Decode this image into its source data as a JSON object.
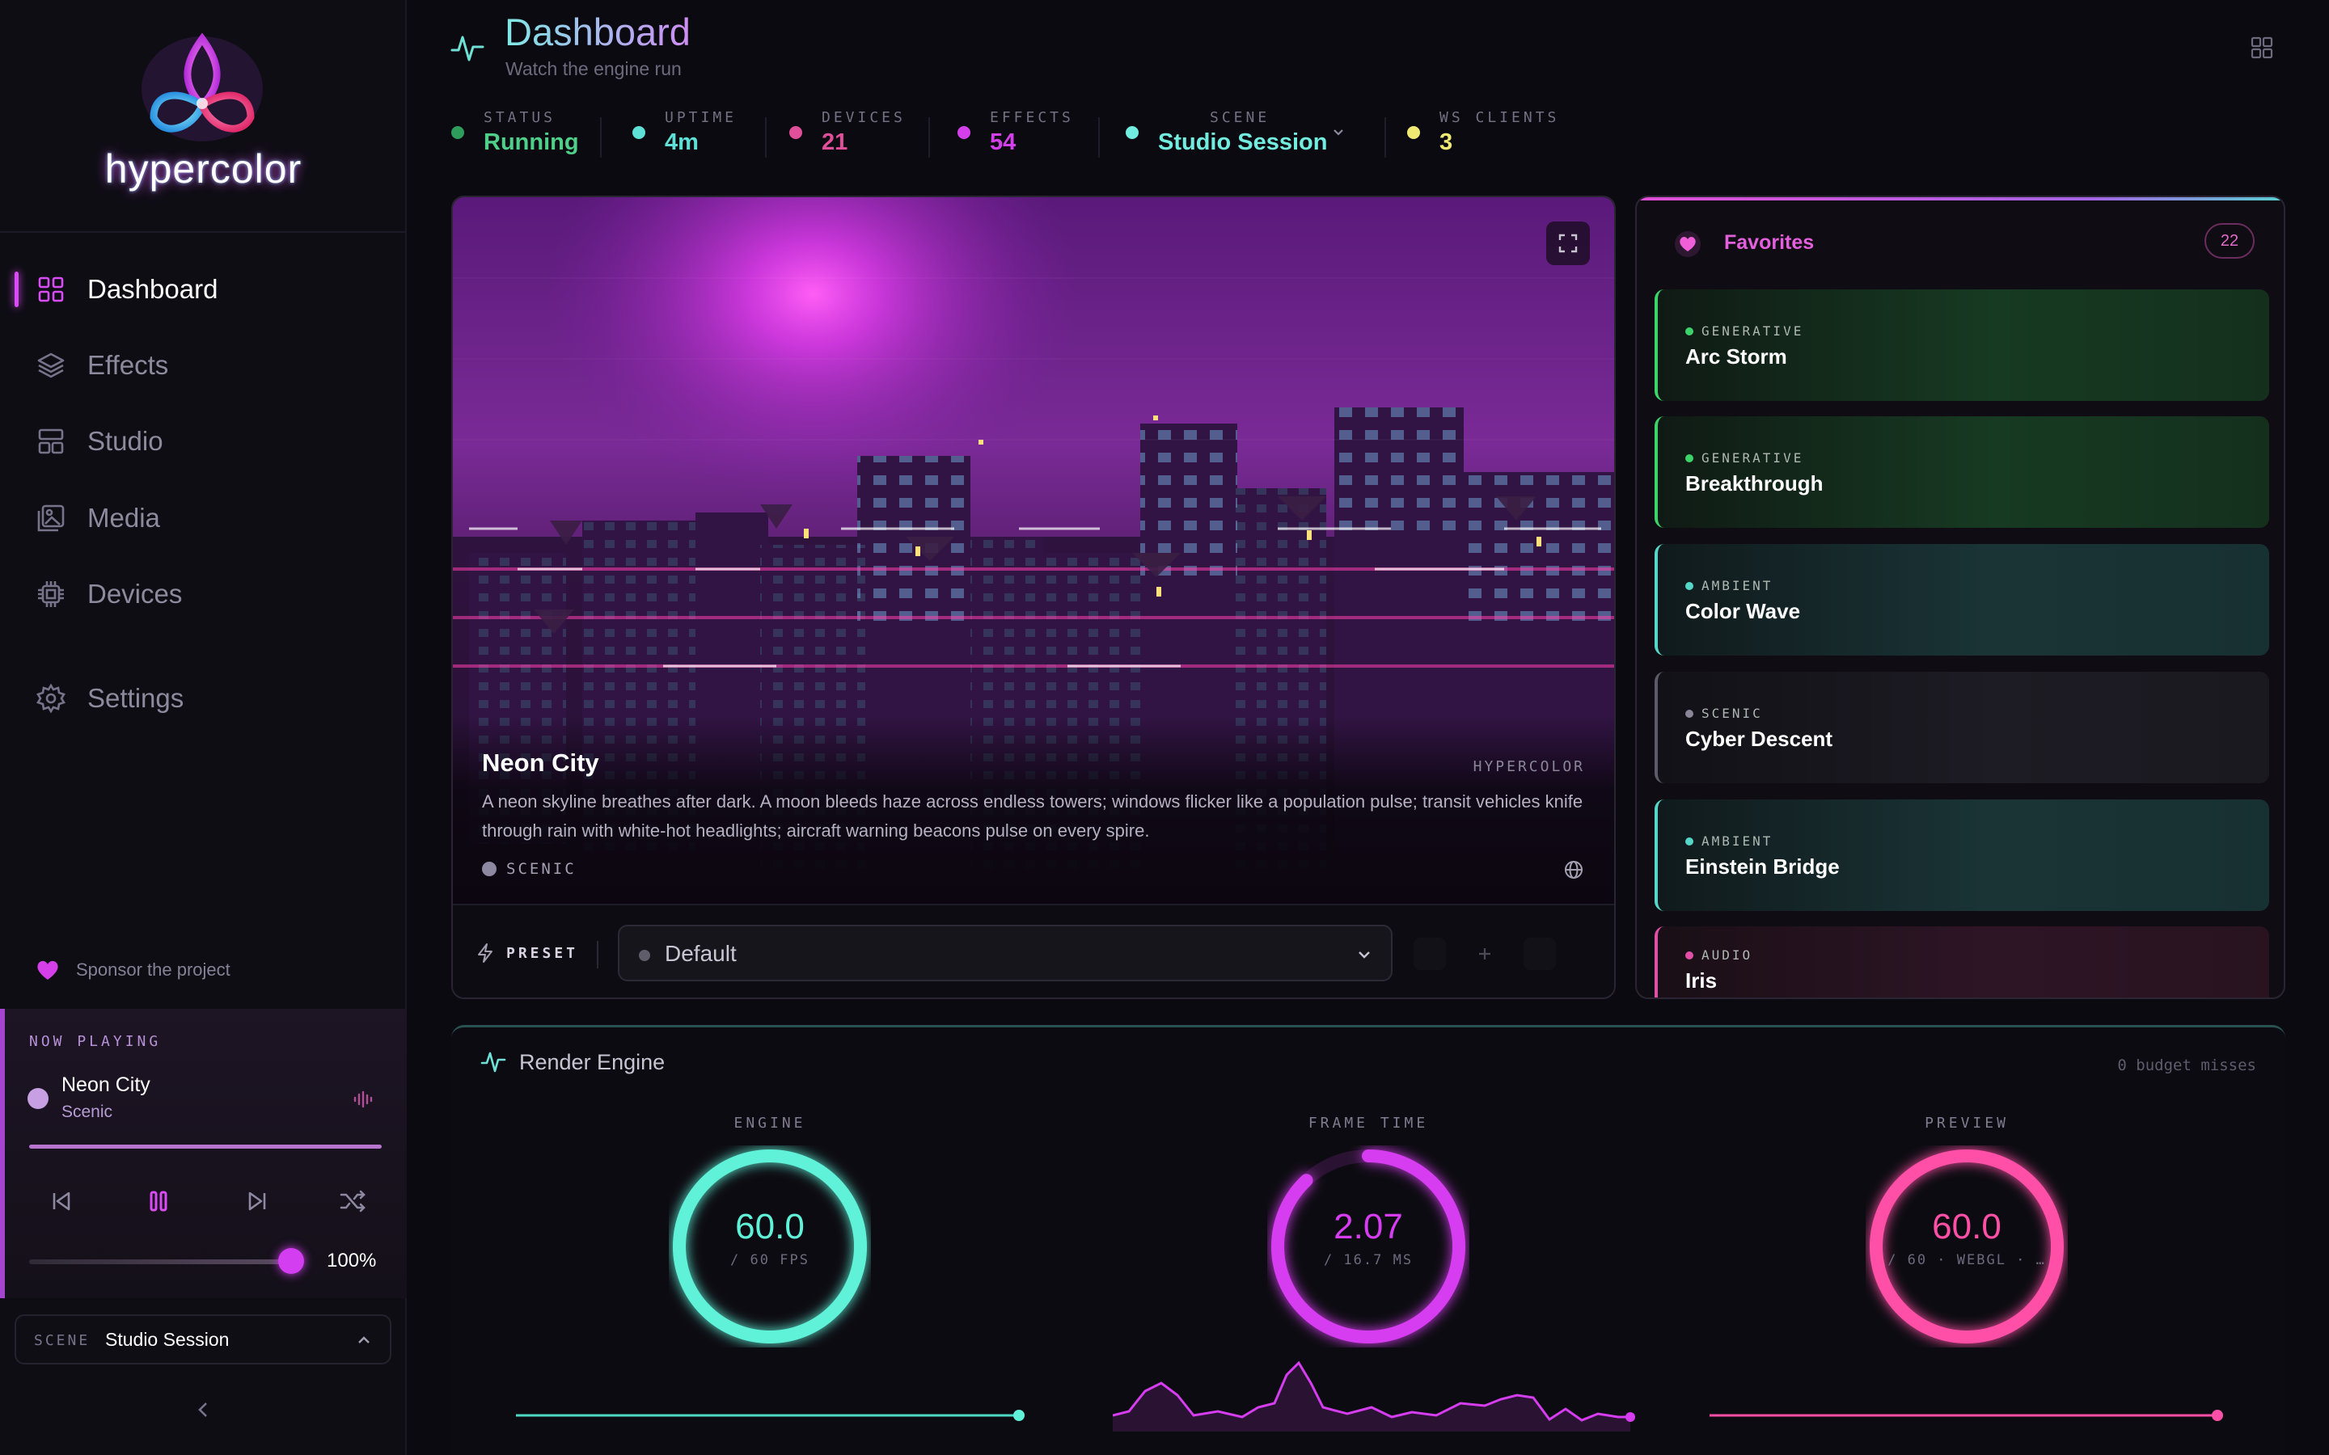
{
  "app": {
    "logo_text": "hypercolor"
  },
  "nav": {
    "items": [
      {
        "label": "Dashboard",
        "icon": "dashboard-icon",
        "active": true
      },
      {
        "label": "Effects",
        "icon": "layers-icon"
      },
      {
        "label": "Studio",
        "icon": "studio-icon"
      },
      {
        "label": "Media",
        "icon": "media-icon"
      },
      {
        "label": "Devices",
        "icon": "chip-icon"
      },
      {
        "label": "Settings",
        "icon": "gear-icon"
      }
    ]
  },
  "sponsor": {
    "label": "Sponsor the project"
  },
  "now_playing": {
    "title": "NOW PLAYING",
    "effect": "Neon City",
    "category": "Scenic",
    "volume": "100%",
    "volume_fraction": 1.0,
    "progress_fraction": 1.0
  },
  "scene_select": {
    "label": "SCENE",
    "value": "Studio Session"
  },
  "header": {
    "title": "Dashboard",
    "subtitle": "Watch the engine run"
  },
  "stats": [
    {
      "label": "STATUS",
      "value": "Running",
      "color": "#4ed08a"
    },
    {
      "label": "UPTIME",
      "value": "4m",
      "color": "#5ee0d6"
    },
    {
      "label": "DEVICES",
      "value": "21",
      "color": "#e0509a"
    },
    {
      "label": "EFFECTS",
      "value": "54",
      "color": "#d340ea"
    },
    {
      "label": "SCENE",
      "value": "Studio Session",
      "color": "#73ece0"
    },
    {
      "label": "WS CLIENTS",
      "value": "3",
      "color": "#f0ea72"
    }
  ],
  "preview": {
    "effect_name": "Neon City",
    "brand": "HYPERCOLOR",
    "description": "A neon skyline breathes after dark. A moon bleeds haze across endless towers; windows flicker like a population pulse; transit vehicles knife through rain with white-hot headlights; aircraft warning beacons pulse on every spire.",
    "category": "SCENIC"
  },
  "preset": {
    "label": "PRESET",
    "value": "Default"
  },
  "favorites": {
    "title": "Favorites",
    "count": "22",
    "items": [
      {
        "category": "GENERATIVE",
        "name": "Arc Storm",
        "accent": "#3cd36a"
      },
      {
        "category": "GENERATIVE",
        "name": "Breakthrough",
        "accent": "#3cd36a"
      },
      {
        "category": "AMBIENT",
        "name": "Color Wave",
        "accent": "#56d6c6"
      },
      {
        "category": "SCENIC",
        "name": "Cyber Descent",
        "accent": "#8a8698"
      },
      {
        "category": "AMBIENT",
        "name": "Einstein Bridge",
        "accent": "#56d6c6"
      },
      {
        "category": "AUDIO",
        "name": "Iris",
        "accent": "#e24fa6"
      }
    ]
  },
  "render": {
    "title": "Render Engine",
    "misses": "0 budget misses",
    "gauges": [
      {
        "label": "ENGINE",
        "value": "60.0",
        "sub": "/ 60 FPS",
        "color": "#5ff2d9",
        "fraction": 1.0
      },
      {
        "label": "FRAME TIME",
        "value": "2.07",
        "sub": "/ 16.7 MS",
        "color": "#d63df0",
        "fraction": 0.88
      },
      {
        "label": "PREVIEW",
        "value": "60.0",
        "sub": "/ 60 · WEBGL · …",
        "color": "#ff4fa7",
        "fraction": 1.0
      }
    ]
  }
}
